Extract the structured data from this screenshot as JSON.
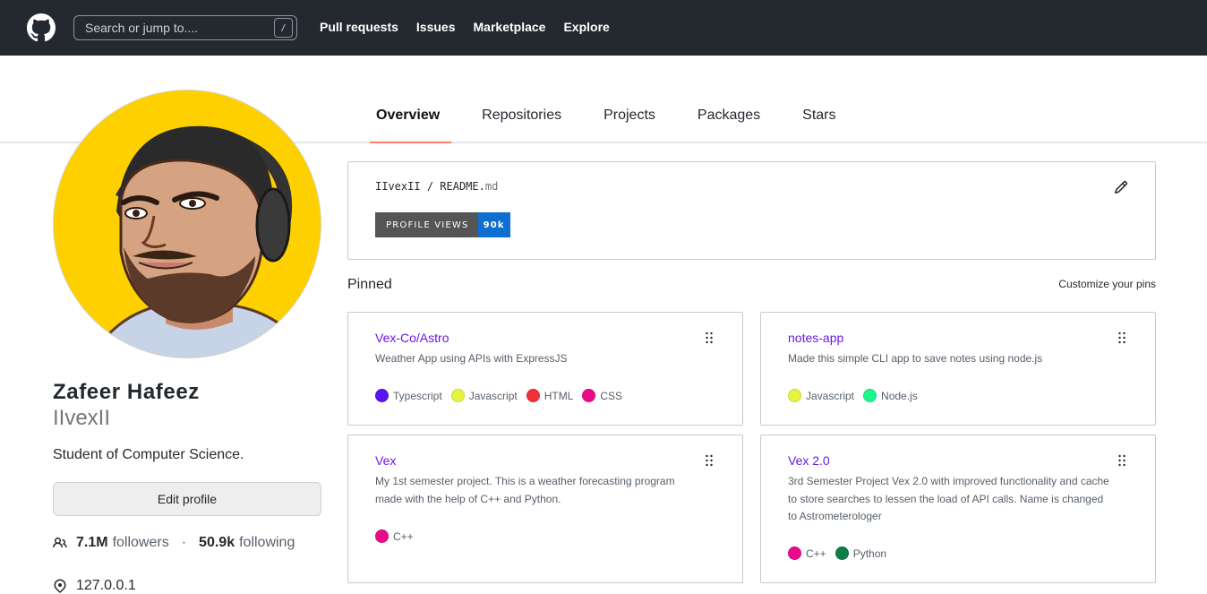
{
  "header": {
    "search_placeholder": "Search or jump to....",
    "search_shortcut": "/",
    "nav": [
      "Pull requests",
      "Issues",
      "Marketplace",
      "Explore"
    ]
  },
  "tabs": [
    {
      "label": "Overview",
      "active": true
    },
    {
      "label": "Repositories",
      "active": false
    },
    {
      "label": "Projects",
      "active": false
    },
    {
      "label": "Packages",
      "active": false
    },
    {
      "label": "Stars",
      "active": false
    }
  ],
  "profile": {
    "full_name": "Zafeer Hafeez",
    "username": "IIvexII",
    "bio": "Student of Computer Science.",
    "edit_label": "Edit profile",
    "followers_count": "7.1M",
    "followers_label": "followers",
    "separator": "·",
    "following_count": "50.9k",
    "following_label": "following",
    "location": "127.0.0.1"
  },
  "readme": {
    "owner": "IIvexII",
    "slash": "/",
    "file": "README.",
    "ext": "md",
    "badge_label": "PROFILE VIEWS",
    "badge_value": "90k"
  },
  "pinned": {
    "title": "Pinned",
    "customize_label": "Customize your pins",
    "repos": [
      {
        "name": "Vex-Co/Astro",
        "description": "Weather App using APIs with ExpressJS",
        "languages": [
          {
            "name": "Typescript",
            "color": "#5b14f2"
          },
          {
            "name": "Javascript",
            "color": "#e6f43f"
          },
          {
            "name": "HTML",
            "color": "#f0303c"
          },
          {
            "name": "CSS",
            "color": "#ea0a8c"
          }
        ]
      },
      {
        "name": "notes-app",
        "description": "Made this simple CLI app to save notes using node.js",
        "languages": [
          {
            "name": "Javascript",
            "color": "#e6f43f"
          },
          {
            "name": "Node.js",
            "color": "#1ff58a"
          }
        ]
      },
      {
        "name": "Vex",
        "description": "My 1st semester project. This is a weather forecasting program made with the help of C++ and Python.",
        "languages": [
          {
            "name": "C++",
            "color": "#ea0a8c"
          }
        ]
      },
      {
        "name": "Vex 2.0",
        "description": "3rd Semester Project Vex 2.0 with improved functionality and cache to store searches to lessen the load of API calls. Name is changed to Astrometerologer",
        "languages": [
          {
            "name": "C++",
            "color": "#ea0a8c"
          },
          {
            "name": "Python",
            "color": "#0e7c48"
          }
        ]
      }
    ]
  },
  "colors": {
    "header_bg": "#24292f",
    "active_tab_underline": "#f78166",
    "repo_link": "#6a17e8",
    "badge_value_bg": "#0e6fd1"
  }
}
